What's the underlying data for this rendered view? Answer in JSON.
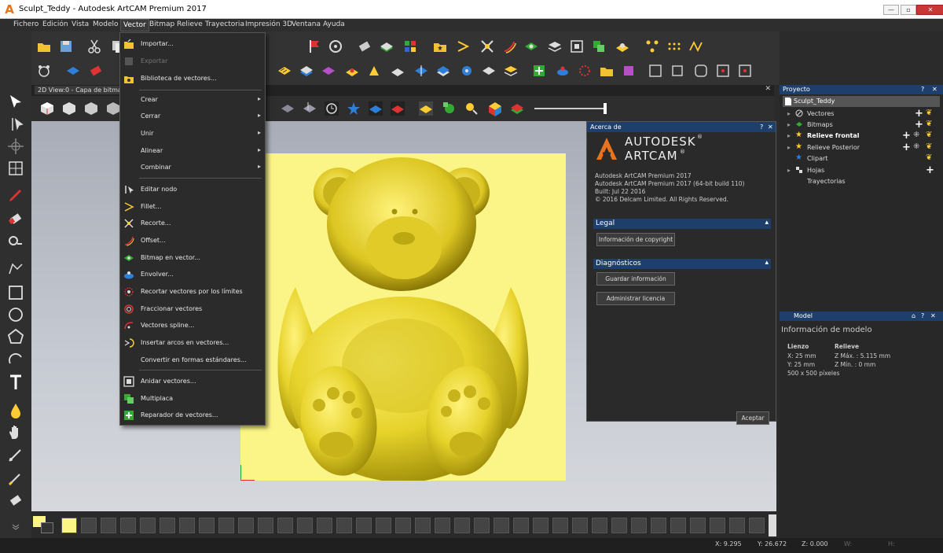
{
  "window": {
    "title": "Sculpt_Teddy - Autodesk ArtCAM Premium 2017",
    "minimize": "—",
    "maximize": "▫",
    "close": "✕"
  },
  "menus": [
    "Fichero",
    "Edición",
    "Vista",
    "Modelo",
    "Vector",
    "Bitmap",
    "Relieve",
    "Trayectoria",
    "Impresión 3D",
    "Ventana",
    "Ayuda"
  ],
  "view_tab": {
    "label": "2D View:0 - Capa de bitmap",
    "close": "✕"
  },
  "vector_menu": [
    {
      "label": "Importar...",
      "disabled": false
    },
    {
      "label": "Exportar",
      "disabled": true
    },
    {
      "label": "Biblioteca de vectores...",
      "disabled": false
    },
    {
      "label": "Crear",
      "submenu": true
    },
    {
      "label": "Cerrar",
      "submenu": true
    },
    {
      "label": "Unir",
      "submenu": true
    },
    {
      "label": "Alinear",
      "submenu": true
    },
    {
      "label": "Combinar",
      "submenu": true
    },
    {
      "label": "Editar nodo"
    },
    {
      "label": "Fillet..."
    },
    {
      "label": "Recorte..."
    },
    {
      "label": "Offset..."
    },
    {
      "label": "Bitmap en vector..."
    },
    {
      "label": "Envolver..."
    },
    {
      "label": "Recortar vectores por los límites"
    },
    {
      "label": "Fraccionar vectores"
    },
    {
      "label": "Vectores spline..."
    },
    {
      "label": "Insertar arcos en vectores..."
    },
    {
      "label": "Convertir en formas estándares..."
    },
    {
      "label": "Anidar vectores..."
    },
    {
      "label": "Multiplaca"
    },
    {
      "label": "Reparador de vectores..."
    }
  ],
  "about": {
    "title": "Acerca de",
    "help": "?",
    "close": "✕",
    "brand_top": "AUTODESK",
    "brand_bottom": "ARTCAM",
    "reg": "®",
    "lines": [
      "Autodesk ArtCAM Premium 2017",
      "Autodesk ArtCAM Premium 2017 (64-bit build 110)",
      "Built: Jul 22 2016",
      "© 2016 Delcam Limited. All Rights Reserved."
    ],
    "legal": "Legal",
    "copyright_btn": "Información de copyright",
    "diagnostics": "Diagnósticos",
    "save_btn": "Guardar información",
    "license_btn": "Administrar licencia",
    "accept_btn": "Aceptar"
  },
  "project": {
    "title": "Proyecto",
    "help": "?",
    "close": "✕",
    "root": "Sculpt_Teddy",
    "items": [
      "Vectores",
      "Bitmaps",
      "Relieve frontal",
      "Relieve Posterior",
      "Clipart",
      "Hojas",
      "Trayectorias"
    ]
  },
  "model": {
    "title": "Model",
    "info_title": "Información de modelo",
    "col1_head": "Lienzo",
    "col2_head": "Relieve",
    "col1": [
      "X: 25 mm",
      "Y: 25 mm",
      "500 x 500 píxeles"
    ],
    "col2": [
      "Z Máx. : 5.115 mm",
      "Z Mín. : 0 mm"
    ]
  },
  "status": {
    "x": "X: 9.295",
    "y": "Y: 26.672",
    "z": "Z: 0.000",
    "w": "W:",
    "h": "H:"
  },
  "colors": {
    "accent": "#1e3f6b",
    "canvas": "#fbf587",
    "bear": "#d9c51c"
  }
}
